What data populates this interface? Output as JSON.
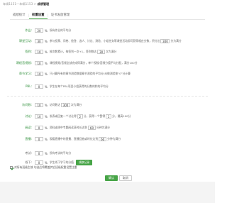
{
  "breadcrumb": {
    "part1": "车辆1151一车辆1153",
    "sep": " > ",
    "current": "成绩管理"
  },
  "tabs": [
    {
      "label": "成绩统计",
      "active": false
    },
    {
      "label": "权重设置",
      "active": true
    },
    {
      "label": "证书发放管理",
      "active": false
    }
  ],
  "tab_sep": "|",
  "rows": {
    "homework": {
      "label": "作业:",
      "value": "20",
      "unit": "%",
      "desc": "所有作业的平均分"
    },
    "class_interaction": {
      "label": "课堂互动:",
      "value": "30",
      "unit": "%",
      "desc": "参与投票、问卷、抢答、选人、讨论、测验、小组任务等课堂活动即可获得相应分数，积分达",
      "value2": "300",
      "desc2": "分为满分"
    },
    "sign_in": {
      "label": "签到:",
      "value": "10",
      "unit": "%",
      "desc": "按次数累计，每签到一次+1，签到数达",
      "value2": "30",
      "desc2": "次为满分"
    },
    "video": {
      "label": "课程音视频:",
      "value": "10",
      "unit": "%",
      "desc": "课程视频/音频全部完成得满分，单个视频/音频分值平均分配，满分100分"
    },
    "chapter_study": {
      "label": "章节学习:",
      "value": "10",
      "unit": "%",
      "desc": "只计算所有的章节测验数据章节测验的平均分(未做测验按“0”分计算"
    },
    "pbl": {
      "label": "PBL:",
      "value": "0",
      "unit": "%",
      "desc": "学生在每个PBL项目小组获得的分数的和的平均分"
    },
    "visits": {
      "label": "访问数:",
      "value": "10",
      "unit": "%",
      "desc": "访问数达",
      "value2": "300",
      "desc2": "次为满分"
    },
    "discussion": {
      "label": "讨论:",
      "value": "10",
      "unit": "%",
      "desc": "发表或回复一个讨论得",
      "value2": "2",
      "desc2": "分，获得一个赞得",
      "value3": "1",
      "desc3": "分，最高100分"
    },
    "reading": {
      "label": "阅读:",
      "value": "0",
      "unit": "%",
      "desc": "资料或线中专题阅读获时长达到",
      "value2": "60",
      "desc2": "分钟为满分"
    },
    "live": {
      "label": "直播:",
      "value": "0",
      "unit": "%",
      "desc": "观看直播中的直播、直播回放或时长达到",
      "value2": "60",
      "desc2": "分钟为满分"
    },
    "exam": {
      "label": "考试:",
      "value": "0",
      "unit": "%",
      "desc": "所有考试的平均分"
    },
    "offline": {
      "label": "线下:",
      "value": "0",
      "unit": "%",
      "desc": "学生线下学习的分值",
      "button": "线数记录"
    }
  },
  "checkbox_label": "对所有班级生效  勾选后将覆盖其它班级权重设置比重",
  "buttons": {
    "save": "确认",
    "cancel": "取消"
  },
  "colors": {
    "accent": "#47a447",
    "label_green": "#2f8f3a"
  }
}
